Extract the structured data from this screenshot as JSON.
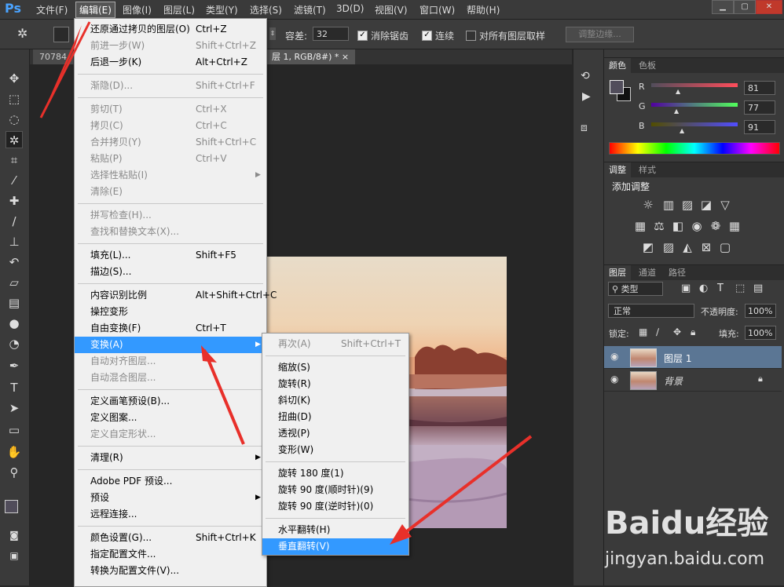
{
  "app": {
    "logo": "Ps"
  },
  "menubar": {
    "items": [
      "文件(F)",
      "编辑(E)",
      "图像(I)",
      "图层(L)",
      "类型(Y)",
      "选择(S)",
      "滤镜(T)",
      "3D(D)",
      "视图(V)",
      "窗口(W)",
      "帮助(H)"
    ],
    "active": "编辑(E)"
  },
  "options": {
    "tolerance_label": "容差:",
    "tolerance_value": "32",
    "antialias_label": "消除锯齿",
    "contiguous_label": "连续",
    "sample_all_label": "对所有图层取样",
    "refine_edge_label": "调整边缘..."
  },
  "tabs": {
    "doc1": "70784",
    "doc2": "层 1, RGB/8#) *",
    "close": "×"
  },
  "edit_menu": {
    "items": [
      {
        "label": "还原通过拷贝的图层(O)",
        "shortcut": "Ctrl+Z",
        "disabled": false
      },
      {
        "label": "前进一步(W)",
        "shortcut": "Shift+Ctrl+Z",
        "disabled": true
      },
      {
        "label": "后退一步(K)",
        "shortcut": "Alt+Ctrl+Z",
        "disabled": false
      },
      {
        "sep": true
      },
      {
        "label": "渐隐(D)...",
        "shortcut": "Shift+Ctrl+F",
        "disabled": true
      },
      {
        "sep": true
      },
      {
        "label": "剪切(T)",
        "shortcut": "Ctrl+X",
        "disabled": true
      },
      {
        "label": "拷贝(C)",
        "shortcut": "Ctrl+C",
        "disabled": true
      },
      {
        "label": "合并拷贝(Y)",
        "shortcut": "Shift+Ctrl+C",
        "disabled": true
      },
      {
        "label": "粘贴(P)",
        "shortcut": "Ctrl+V",
        "disabled": true
      },
      {
        "label": "选择性粘贴(I)",
        "shortcut": "",
        "disabled": true,
        "submenu": true
      },
      {
        "label": "清除(E)",
        "shortcut": "",
        "disabled": true
      },
      {
        "sep": true
      },
      {
        "label": "拼写检查(H)...",
        "shortcut": "",
        "disabled": true
      },
      {
        "label": "查找和替换文本(X)...",
        "shortcut": "",
        "disabled": true
      },
      {
        "sep": true
      },
      {
        "label": "填充(L)...",
        "shortcut": "Shift+F5",
        "disabled": false
      },
      {
        "label": "描边(S)...",
        "shortcut": "",
        "disabled": false
      },
      {
        "sep": true
      },
      {
        "label": "内容识别比例",
        "shortcut": "Alt+Shift+Ctrl+C",
        "disabled": false
      },
      {
        "label": "操控变形",
        "shortcut": "",
        "disabled": false
      },
      {
        "label": "自由变换(F)",
        "shortcut": "Ctrl+T",
        "disabled": false
      },
      {
        "label": "变换(A)",
        "shortcut": "",
        "disabled": false,
        "submenu": true,
        "highlight": true
      },
      {
        "label": "自动对齐图层...",
        "shortcut": "",
        "disabled": true
      },
      {
        "label": "自动混合图层...",
        "shortcut": "",
        "disabled": true
      },
      {
        "sep": true
      },
      {
        "label": "定义画笔预设(B)...",
        "shortcut": "",
        "disabled": false
      },
      {
        "label": "定义图案...",
        "shortcut": "",
        "disabled": false
      },
      {
        "label": "定义自定形状...",
        "shortcut": "",
        "disabled": true
      },
      {
        "sep": true
      },
      {
        "label": "清理(R)",
        "shortcut": "",
        "disabled": false,
        "submenu": true
      },
      {
        "sep": true
      },
      {
        "label": "Adobe PDF 预设...",
        "shortcut": "",
        "disabled": false
      },
      {
        "label": "预设",
        "shortcut": "",
        "disabled": false,
        "submenu": true
      },
      {
        "label": "远程连接...",
        "shortcut": "",
        "disabled": false
      },
      {
        "sep": true
      },
      {
        "label": "颜色设置(G)...",
        "shortcut": "Shift+Ctrl+K",
        "disabled": false
      },
      {
        "label": "指定配置文件...",
        "shortcut": "",
        "disabled": false
      },
      {
        "label": "转换为配置文件(V)...",
        "shortcut": "",
        "disabled": false
      }
    ]
  },
  "transform_menu": {
    "items": [
      {
        "label": "再次(A)",
        "shortcut": "Shift+Ctrl+T",
        "disabled": true
      },
      {
        "sep": true
      },
      {
        "label": "缩放(S)",
        "shortcut": "",
        "disabled": false
      },
      {
        "label": "旋转(R)",
        "shortcut": "",
        "disabled": false
      },
      {
        "label": "斜切(K)",
        "shortcut": "",
        "disabled": false
      },
      {
        "label": "扭曲(D)",
        "shortcut": "",
        "disabled": false
      },
      {
        "label": "透视(P)",
        "shortcut": "",
        "disabled": false
      },
      {
        "label": "变形(W)",
        "shortcut": "",
        "disabled": false
      },
      {
        "sep": true
      },
      {
        "label": "旋转 180 度(1)",
        "shortcut": "",
        "disabled": false
      },
      {
        "label": "旋转 90 度(顺时针)(9)",
        "shortcut": "",
        "disabled": false
      },
      {
        "label": "旋转 90 度(逆时针)(0)",
        "shortcut": "",
        "disabled": false
      },
      {
        "sep": true
      },
      {
        "label": "水平翻转(H)",
        "shortcut": "",
        "disabled": false
      },
      {
        "label": "垂直翻转(V)",
        "shortcut": "",
        "disabled": false,
        "highlight": true
      }
    ]
  },
  "color_panel": {
    "tabs": [
      "颜色",
      "色板"
    ],
    "r_label": "R",
    "r_value": "81",
    "g_label": "G",
    "g_value": "77",
    "b_label": "B",
    "b_value": "91",
    "foreground": "#514d5b"
  },
  "adjust_panel": {
    "tabs": [
      "调整",
      "样式"
    ],
    "title": "添加调整"
  },
  "layers_panel": {
    "tabs": [
      "图层",
      "通道",
      "路径"
    ],
    "filter_label": "类型",
    "blend_mode": "正常",
    "opacity_label": "不透明度:",
    "opacity_value": "100%",
    "lock_label": "锁定:",
    "fill_label": "填充:",
    "fill_value": "100%",
    "layers": [
      {
        "name": "图层 1",
        "selected": true,
        "locked": false
      },
      {
        "name": "背景",
        "selected": false,
        "locked": true
      }
    ]
  },
  "watermark": {
    "brand": "Baidu经验",
    "url": "jingyan.baidu.com"
  },
  "colors": {
    "accent": "#3399ff",
    "arrow": "#e8302a",
    "layer_selected": "#5b7694"
  }
}
